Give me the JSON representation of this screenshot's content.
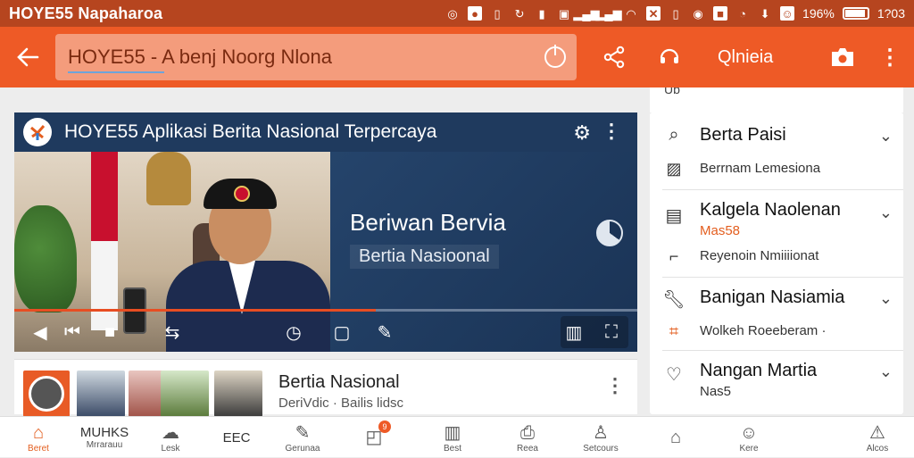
{
  "status_bar": {
    "title": "HOYE55 Napaharoa",
    "battery": "196%",
    "time": "1?03"
  },
  "toolbar": {
    "search_value": "HOYE55 - A benj Noorg Nlona",
    "profile_label": "Qlnieia"
  },
  "video": {
    "title": "HOYE55 Aplikasi Berita Nasional Terpercaya",
    "headline": "Beriwan Bervia",
    "subline": "Bertia Nasioonal",
    "progress": 0.58
  },
  "info_row": {
    "title": "Bertia Nasional",
    "subtitle": "DeriVdic  ·  Bailis lidsc"
  },
  "side_panel": {
    "top_partial": "Ub",
    "items": [
      {
        "label": "Berta Paisi",
        "sub": "Berrnam Lemesiona"
      },
      {
        "label": "Kalgela Naolenan",
        "tag": "Mas58",
        "sub": "Reyenoin Nmiiiionat"
      },
      {
        "label": "Banigan Nasiamia",
        "sub": "Wolkeh Roeeberam ·"
      },
      {
        "label": "Nangan Martia",
        "tag": "Nas5"
      }
    ]
  },
  "bottom_nav": {
    "items": [
      {
        "label": "Beret"
      },
      {
        "title": "MUHKS",
        "label": "Mrrarauu"
      },
      {
        "label": "Lesk"
      },
      {
        "title": "EEC"
      },
      {
        "label": "Gerunaa"
      },
      {
        "label": "",
        "badge": "9"
      },
      {
        "label": "Best"
      },
      {
        "label": "Reea"
      },
      {
        "label": "Setcours"
      },
      {
        "label": ""
      },
      {
        "label": "Kere"
      },
      {
        "label": "Alcos"
      }
    ]
  },
  "colors": {
    "accent": "#ee5a26",
    "status_bar": "#b6451f",
    "video_bg": "#1f3a5e"
  }
}
